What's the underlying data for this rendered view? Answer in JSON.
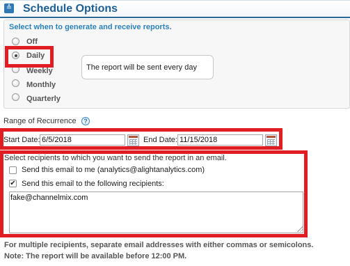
{
  "header": {
    "title": "Schedule Options",
    "collapse_icon": "chevron-double-down-icon"
  },
  "frequency": {
    "instruction": "Select when to generate and receive reports.",
    "options": [
      {
        "label": "Off",
        "selected": false
      },
      {
        "label": "Daily",
        "selected": true
      },
      {
        "label": "Weekly",
        "selected": false
      },
      {
        "label": "Monthly",
        "selected": false
      },
      {
        "label": "Quarterly",
        "selected": false
      }
    ],
    "info_text": "The report will be sent every day"
  },
  "range": {
    "label": "Range of Recurrence",
    "help_glyph": "?",
    "start_label": "Start Date:",
    "start_value": "6/5/2018",
    "end_label": "End Date:",
    "end_value": "11/15/2018"
  },
  "recipients": {
    "instruction": "Select recipients to which you want to send the report in an email.",
    "send_to_me_label": "Send this email to me (analytics@alightanalytics.com)",
    "send_to_me_checked": false,
    "send_to_list_label": "Send this email to the following recipients:",
    "send_to_list_checked": true,
    "checkmark_glyph": "✔",
    "emails": "fake@channelmix.com"
  },
  "notes": {
    "separator_hint": "For multiple recipients, separate email addresses with either commas or semicolons.",
    "availability": "Note: The report will be available before 12:00 PM."
  },
  "colors": {
    "header_title": "#1e5f93",
    "accent_blue": "#2a82b9",
    "highlight_red": "#e11d24"
  }
}
